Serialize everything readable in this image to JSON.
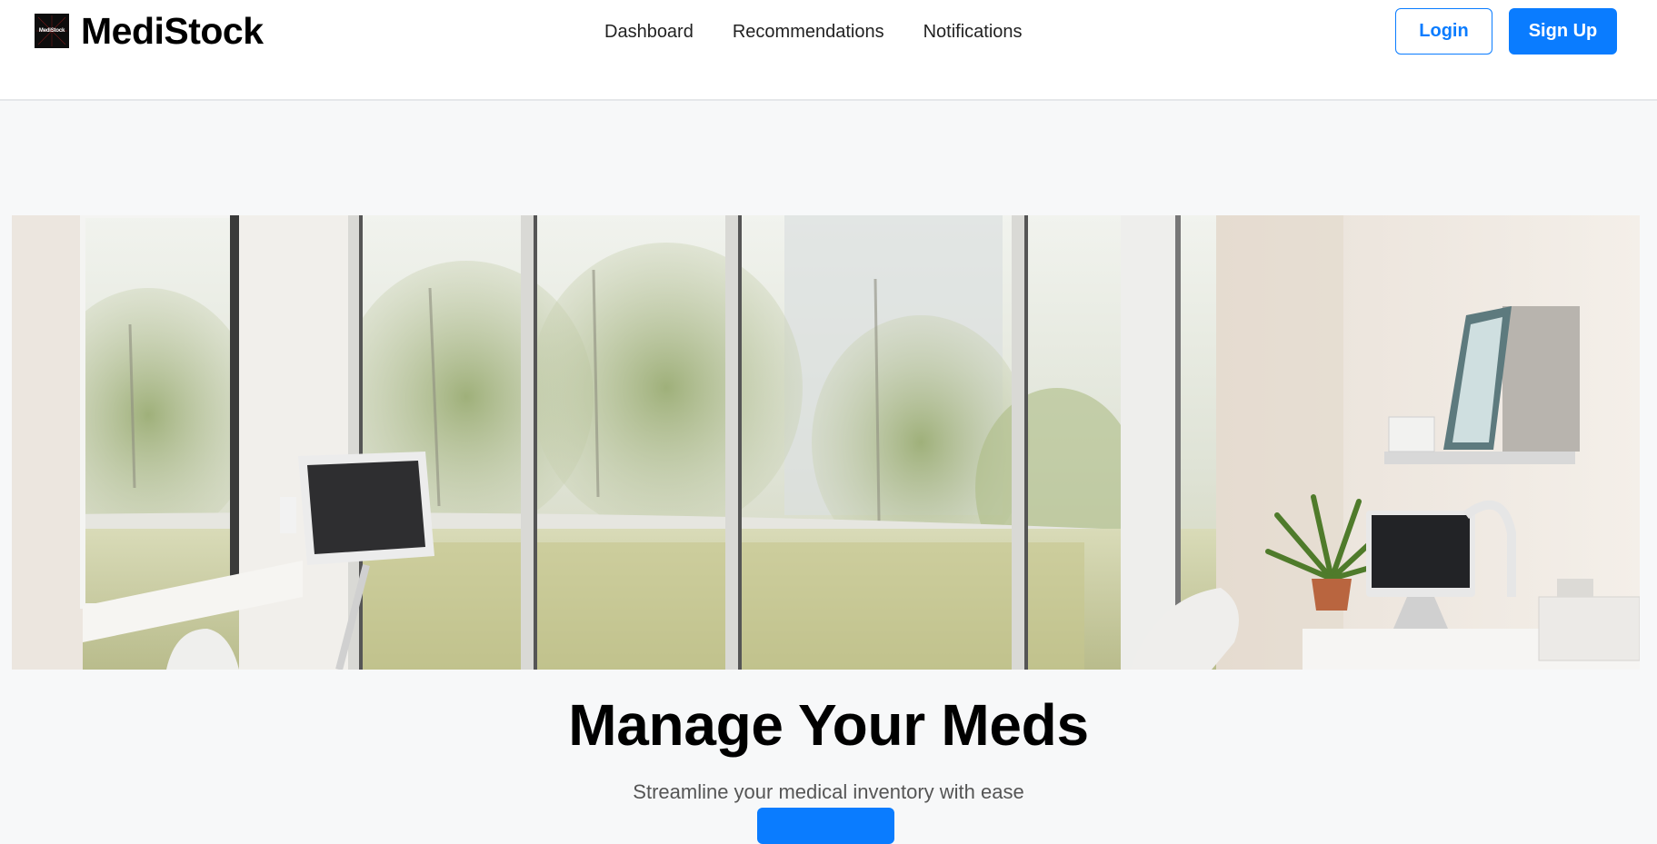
{
  "header": {
    "logo_text": "MediStock",
    "brand_name": "MediStock",
    "nav": [
      {
        "label": "Dashboard"
      },
      {
        "label": "Recommendations"
      },
      {
        "label": "Notifications"
      }
    ],
    "login_label": "Login",
    "signup_label": "Sign Up"
  },
  "hero": {
    "image_icon": "clinic-office-photo",
    "headline": "Manage Your Meds",
    "subheadline": "Streamline your medical inventory with ease",
    "cta_label": ""
  },
  "colors": {
    "accent": "#0a7cff",
    "page_bg": "#f7f8f9",
    "header_bg": "#ffffff",
    "text_dark": "#000000",
    "text_muted": "#555555"
  }
}
